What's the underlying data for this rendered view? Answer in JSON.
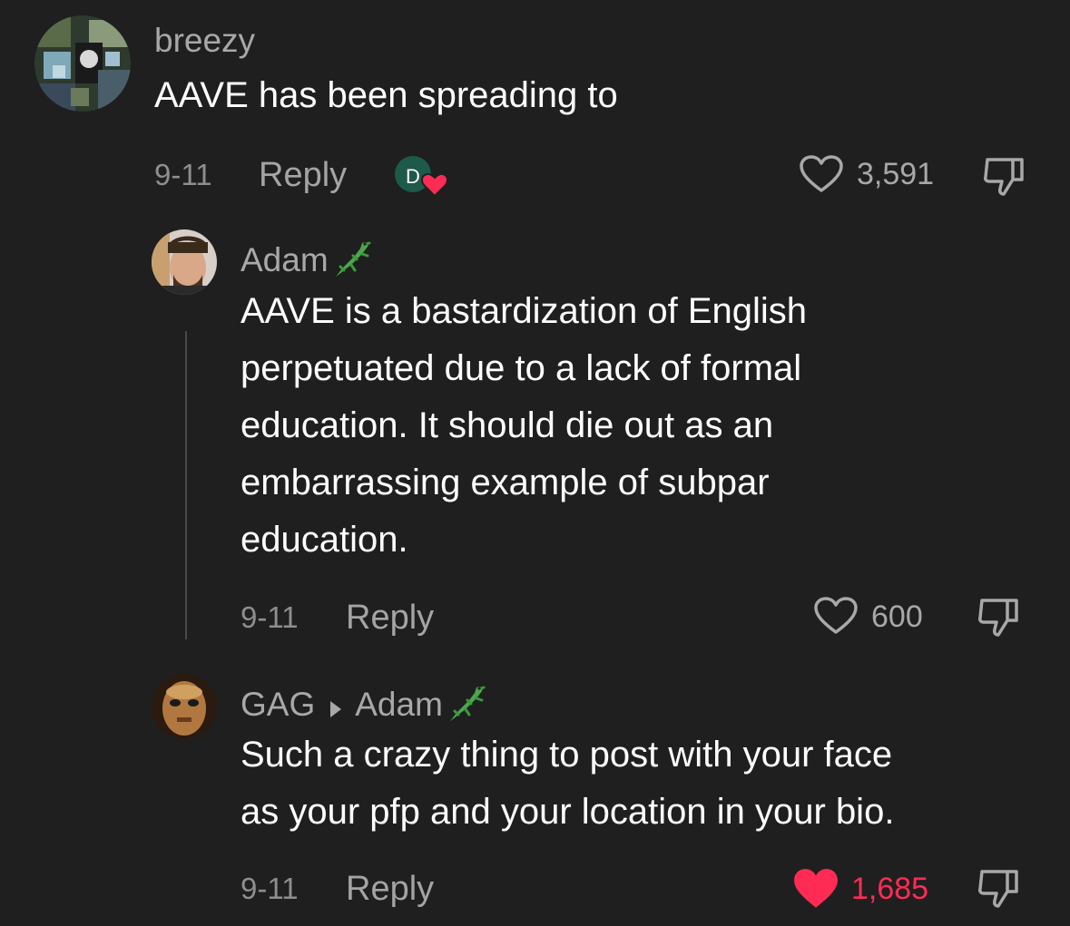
{
  "comments": [
    {
      "username": "breezy",
      "text_lines": [
        "AAVE has been spreading to"
      ],
      "date": "9-11",
      "reply_label": "Reply",
      "author_like_initial": "D",
      "like_count": "3,591",
      "liked": false
    },
    {
      "username": "Adam",
      "username_emoji": "lizard",
      "text_lines": [
        "AAVE is a bastardization of English",
        "perpetuated due to a lack of formal",
        "education. It should die out as an",
        "embarrassing example of subpar",
        "education."
      ],
      "date": "9-11",
      "reply_label": "Reply",
      "like_count": "600",
      "liked": false
    },
    {
      "username": "GAG",
      "reply_to": "Adam",
      "username_emoji": "lizard",
      "text_lines": [
        "Such a crazy thing to post with your face",
        "as your pfp and your location in your bio."
      ],
      "date": "9-11",
      "reply_label": "Reply",
      "like_count": "1,685",
      "liked": true
    }
  ],
  "colors": {
    "background": "#1f1f1f",
    "liked": "#fe2c55",
    "muted": "#a8a8a8",
    "author_badge": "#1e5a4a"
  }
}
